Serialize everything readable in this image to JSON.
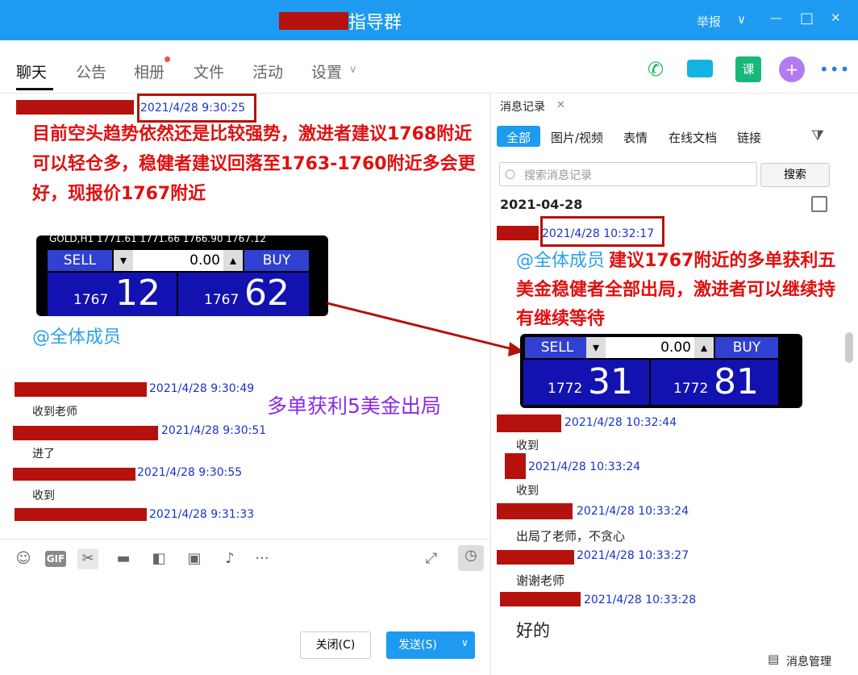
{
  "window": {
    "title": "指导群",
    "report_label": "举报",
    "min": "—",
    "max": "□",
    "close": "✕",
    "chevron": "∨"
  },
  "tabs": [
    {
      "label": "聊天"
    },
    {
      "label": "公告"
    },
    {
      "label": "相册"
    },
    {
      "label": "文件"
    },
    {
      "label": "活动"
    },
    {
      "label": "设置"
    }
  ],
  "header_icons": [
    "phone-icon",
    "video-icon",
    "lesson-icon",
    "add-icon",
    "more-icon"
  ],
  "header_lesson_label": "课",
  "chat": {
    "msg1": {
      "time": "2021/4/28 9:30:25",
      "text": "目前空头趋势依然还是比较强势，激进者建议1768附近可以轻仓多，稳健者建议回落至1763-1760附近多会更好，现报价1767附近",
      "mention": "@全体成员"
    },
    "trade1": {
      "symbol": "GOLD,H1",
      "prices": "1771.61  1771.66  1766.90  1767.12",
      "sell": "SELL",
      "buy": "BUY",
      "lot": "0.00",
      "sell_big": "12",
      "sell_small": "1767",
      "buy_big": "62",
      "buy_small": "1767"
    },
    "overlay": "多单获利5美金出局",
    "msgs": [
      {
        "time": "2021/4/28 9:30:49",
        "text": "收到老师"
      },
      {
        "time": "2021/4/28 9:30:51",
        "text": "进了"
      },
      {
        "time": "2021/4/28 9:30:55",
        "text": "收到"
      },
      {
        "time": "2021/4/28 9:31:33",
        "text": ""
      }
    ]
  },
  "toolbar": {
    "close_label": "关闭(C)",
    "send_label": "发送(S)"
  },
  "history": {
    "tab_label": "消息记录",
    "filters": [
      "全部",
      "图片/视频",
      "表情",
      "在线文档",
      "链接"
    ],
    "search_placeholder": "搜索消息记录",
    "search_button": "搜索",
    "date": "2021-04-28",
    "main_time": "2021/4/28 10:32:17",
    "main_mention": "@全体成员",
    "main_text": "建议1767附近的多单获利五美金稳健者全部出局，激进者可以继续持有继续等待",
    "trade2": {
      "sell": "SELL",
      "buy": "BUY",
      "lot": "0.00",
      "sell_big": "31",
      "sell_small": "1772",
      "buy_big": "81",
      "buy_small": "1772"
    },
    "msgs": [
      {
        "time": "2021/4/28 10:32:44",
        "text": "收到"
      },
      {
        "time": "2021/4/28 10:33:24",
        "text": "收到"
      },
      {
        "time": "2021/4/28 10:33:24",
        "text": "出局了老师，不贪心"
      },
      {
        "time": "2021/4/28 10:33:27",
        "text": "谢谢老师"
      },
      {
        "time": "2021/4/28 10:33:28",
        "text": "好的"
      }
    ],
    "manage_label": "消息管理"
  }
}
